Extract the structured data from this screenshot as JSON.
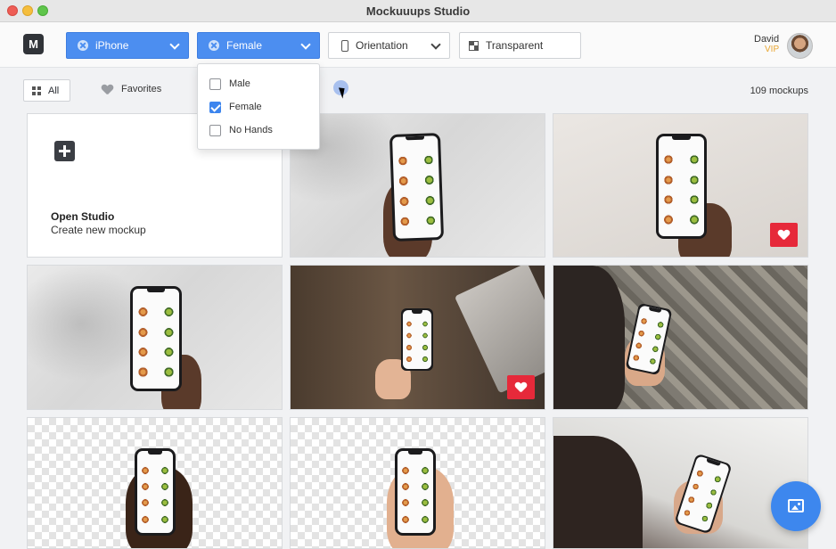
{
  "window": {
    "title": "Mockuuups Studio"
  },
  "toolbar": {
    "logo_letter": "M",
    "filters": [
      {
        "label": "iPhone",
        "active": true
      },
      {
        "label": "Female",
        "active": true
      },
      {
        "label": "Orientation",
        "active": false
      },
      {
        "label": "Transparent",
        "active": false
      }
    ],
    "user": {
      "name": "David",
      "tier": "VIP"
    }
  },
  "subbar": {
    "all_label": "All",
    "favorites_label": "Favorites",
    "count": "109 mockups"
  },
  "dropdown": {
    "options": [
      {
        "label": "Male",
        "checked": false
      },
      {
        "label": "Female",
        "checked": true
      },
      {
        "label": "No Hands",
        "checked": false
      }
    ]
  },
  "studio_card": {
    "title": "Open Studio",
    "subtitle": "Create new mockup"
  },
  "mockups": [
    {
      "scene": "white-wall",
      "favorite": false
    },
    {
      "scene": "cream-wall",
      "favorite": true
    },
    {
      "scene": "white-wall-shadow",
      "favorite": false
    },
    {
      "scene": "wood-desk-laptop",
      "favorite": true
    },
    {
      "scene": "stone-leaves",
      "favorite": false
    },
    {
      "scene": "transparent",
      "favorite": false
    },
    {
      "scene": "transparent",
      "favorite": false
    },
    {
      "scene": "office-desk",
      "favorite": false
    }
  ],
  "colors": {
    "accent": "#4c8ef0",
    "favorite": "#e6293a",
    "vip": "#e8a530"
  }
}
